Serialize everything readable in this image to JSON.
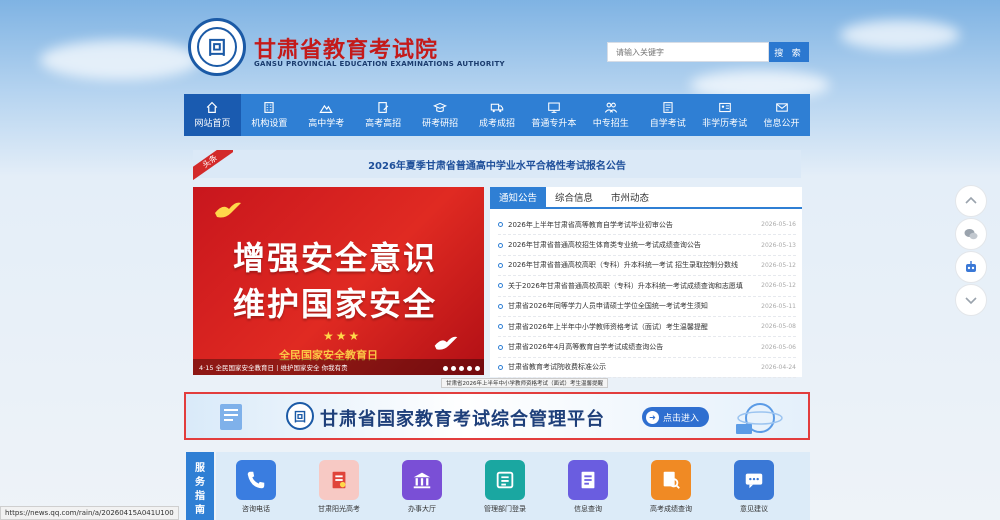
{
  "header": {
    "emblem_char": "回",
    "title": "甘肃省教育考试院",
    "subtitle": "GANSU PROVINCIAL EDUCATION EXAMINATIONS AUTHORITY",
    "search_placeholder": "请输入关键字",
    "search_button": "搜 索"
  },
  "nav": {
    "items": [
      {
        "label": "网站首页",
        "icon": "home-icon",
        "active": true
      },
      {
        "label": "机构设置",
        "icon": "building-icon"
      },
      {
        "label": "高中学考",
        "icon": "mountain-icon"
      },
      {
        "label": "高考高招",
        "icon": "pen-doc-icon"
      },
      {
        "label": "研考研招",
        "icon": "graduation-cap-icon"
      },
      {
        "label": "成考成招",
        "icon": "truck-icon"
      },
      {
        "label": "普通专升本",
        "icon": "monitor-icon"
      },
      {
        "label": "中专招生",
        "icon": "people-icon"
      },
      {
        "label": "自学考试",
        "icon": "book-icon"
      },
      {
        "label": "非学历考试",
        "icon": "id-card-icon"
      },
      {
        "label": "信息公开",
        "icon": "mail-icon"
      }
    ]
  },
  "headline": {
    "ribbon": "头条",
    "text": "2026年夏季甘肃省普通高中学业水平合格性考试报名公告"
  },
  "banner": {
    "line1": "增强安全意识",
    "line2": "维护国家安全",
    "event": "全民国家安全教育日",
    "caption": "4·15 全民国家安全教育日丨维护国家安全 你我有责"
  },
  "news": {
    "tabs": [
      "通知公告",
      "综合信息",
      "市州动态"
    ],
    "items": [
      {
        "title": "2026年上半年甘肃省高等教育自学考试毕业初审公告",
        "date": "2026-05-16"
      },
      {
        "title": "2026年甘肃省普通高校招生体育类专业统一考试成绩查询公告",
        "date": "2026-05-13"
      },
      {
        "title": "2026年甘肃省普通高校高职（专科）升本科统一考试 招生录取控制分数线",
        "date": "2026-05-12"
      },
      {
        "title": "关于2026年甘肃省普通高校高职（专科）升本科统一考试成绩查询和志愿填",
        "date": "2026-05-12"
      },
      {
        "title": "甘肃省2026年同等学力人员申请硕士学位全国统一考试考生须知",
        "date": "2026-05-11"
      },
      {
        "title": "甘肃省2026年上半年中小学教师资格考试（面试）考生温馨提醒",
        "date": "2026-05-08"
      },
      {
        "title": "甘肃省2026年4月高等教育自学考试成绩查询公告",
        "date": "2026-05-06"
      },
      {
        "title": "甘肃省教育考试院收费标准公示",
        "date": "2026-04-24"
      }
    ],
    "tooltip": "甘肃省2026年上半年中小学教师资格考试（面试）考生温馨提醒"
  },
  "platform": {
    "emblem_char": "回",
    "title": "甘肃省国家教育考试综合管理平台",
    "enter": "点击进入"
  },
  "services": {
    "label_chars": [
      "服",
      "务",
      "指",
      "南"
    ],
    "items": [
      {
        "label": "咨询电话",
        "icon": "phone-icon",
        "color": "#3a7de0"
      },
      {
        "label": "甘肃阳光高考",
        "icon": "sun-doc-icon",
        "color": "#e0443a"
      },
      {
        "label": "办事大厅",
        "icon": "hall-icon",
        "color": "#7a4fd6"
      },
      {
        "label": "管理部门登录",
        "icon": "login-icon",
        "color": "#1aa7a1"
      },
      {
        "label": "信息查询",
        "icon": "info-icon",
        "color": "#6a5de0"
      },
      {
        "label": "高考成绩查询",
        "icon": "score-search-icon",
        "color": "#f08a24"
      },
      {
        "label": "意见建议",
        "icon": "feedback-icon",
        "color": "#3a78d6"
      }
    ]
  },
  "status_url": "https://news.qq.com/rain/a/20260415A041U100",
  "colors": {
    "nav": "#2f7fd4",
    "nav_active": "#1a5bb0",
    "title_red": "#c41a1a",
    "platform_border": "#e23d3d"
  }
}
